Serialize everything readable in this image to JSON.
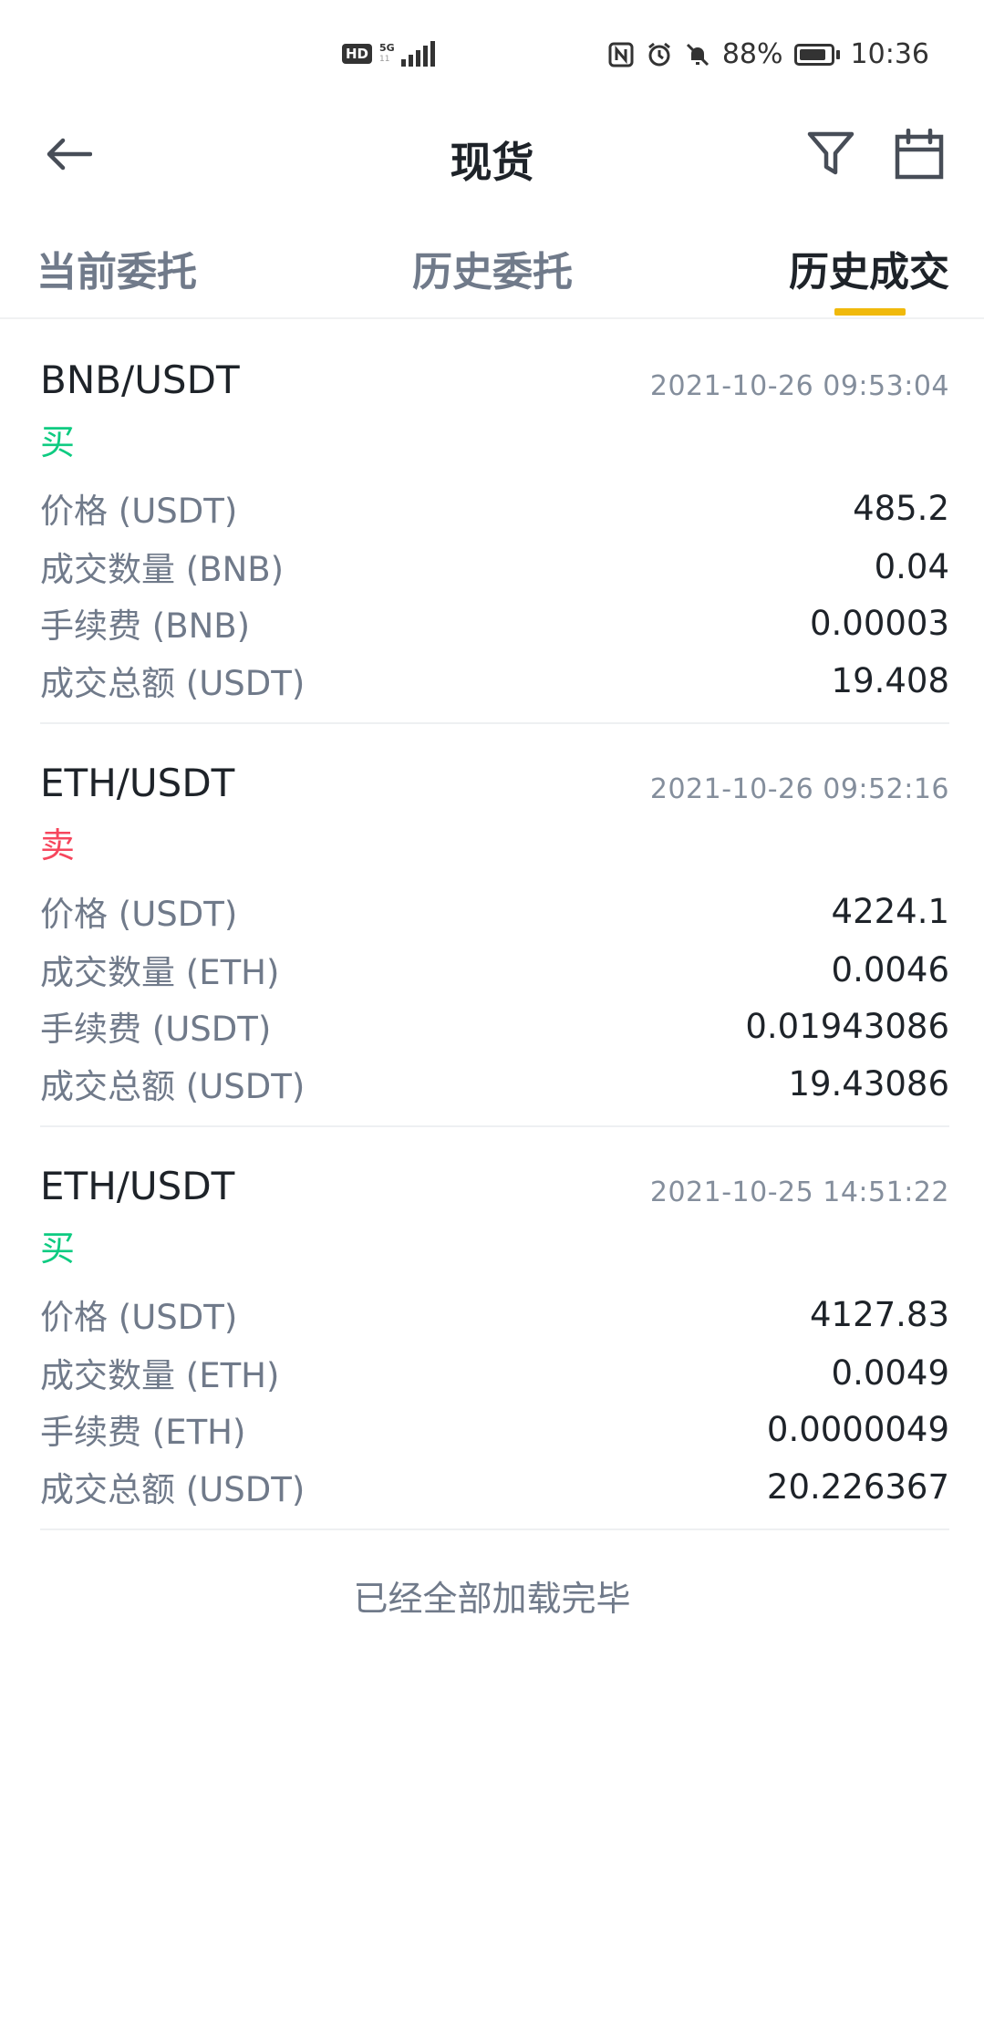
{
  "status_bar": {
    "hd": "HD",
    "network": "5G",
    "network_sub": "11",
    "battery": "88%",
    "time": "10:36",
    "battery_level": 0.88
  },
  "header": {
    "title": "现货",
    "back_icon": "arrow-left-icon",
    "filter_icon": "filter-icon",
    "calendar_icon": "calendar-icon"
  },
  "tabs": [
    {
      "label": "当前委托",
      "active": false
    },
    {
      "label": "历史委托",
      "active": false
    },
    {
      "label": "历史成交",
      "active": true
    }
  ],
  "colors": {
    "buy": "#0ecb81",
    "sell": "#f6465d",
    "accent": "#f0b90b",
    "text_primary": "#1e2329",
    "text_secondary": "#707a8a"
  },
  "trades": [
    {
      "pair": "BNB/USDT",
      "time": "2021-10-26 09:53:04",
      "side": "买",
      "side_type": "buy",
      "rows": [
        {
          "label": "价格 (USDT)",
          "value": "485.2"
        },
        {
          "label": "成交数量 (BNB)",
          "value": "0.04"
        },
        {
          "label": "手续费 (BNB)",
          "value": "0.00003"
        },
        {
          "label": "成交总额 (USDT)",
          "value": "19.408"
        }
      ]
    },
    {
      "pair": "ETH/USDT",
      "time": "2021-10-26 09:52:16",
      "side": "卖",
      "side_type": "sell",
      "rows": [
        {
          "label": "价格 (USDT)",
          "value": "4224.1"
        },
        {
          "label": "成交数量 (ETH)",
          "value": "0.0046"
        },
        {
          "label": "手续费 (USDT)",
          "value": "0.01943086"
        },
        {
          "label": "成交总额 (USDT)",
          "value": "19.43086"
        }
      ]
    },
    {
      "pair": "ETH/USDT",
      "time": "2021-10-25 14:51:22",
      "side": "买",
      "side_type": "buy",
      "rows": [
        {
          "label": "价格 (USDT)",
          "value": "4127.83"
        },
        {
          "label": "成交数量 (ETH)",
          "value": "0.0049"
        },
        {
          "label": "手续费 (ETH)",
          "value": "0.0000049"
        },
        {
          "label": "成交总额 (USDT)",
          "value": "20.226367"
        }
      ]
    }
  ],
  "footer": {
    "note": "已经全部加载完毕"
  }
}
